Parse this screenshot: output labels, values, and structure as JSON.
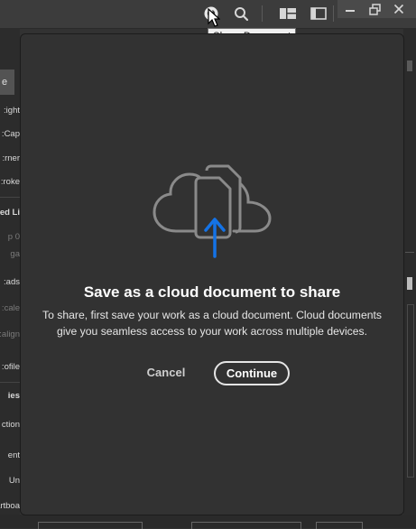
{
  "tooltip": {
    "text": "Share Document"
  },
  "toolbar": {
    "icons": [
      "share-icon",
      "search-icon",
      "workspace-layout-icon",
      "panel-toggle-icon",
      "minimize-icon",
      "restore-icon",
      "close-icon"
    ]
  },
  "left_panel": {
    "tab_label": "e",
    "labels": [
      "ight:",
      "Cap:",
      "rner:",
      "roke:",
      "ned Li",
      "0 p",
      "ga",
      "ads:",
      "cale:",
      "align:",
      "ofile:",
      "ies",
      "ction",
      "ent",
      "Un",
      "artboa"
    ]
  },
  "dialog": {
    "title": "Save as a cloud document to share",
    "body": "To share, first save your work as a cloud document. Cloud documents give you seamless access to your work across multiple devices.",
    "cancel_label": "Cancel",
    "continue_label": "Continue",
    "accent_color": "#1473e6",
    "illustration_icon": "cloud-upload-document-icon"
  }
}
